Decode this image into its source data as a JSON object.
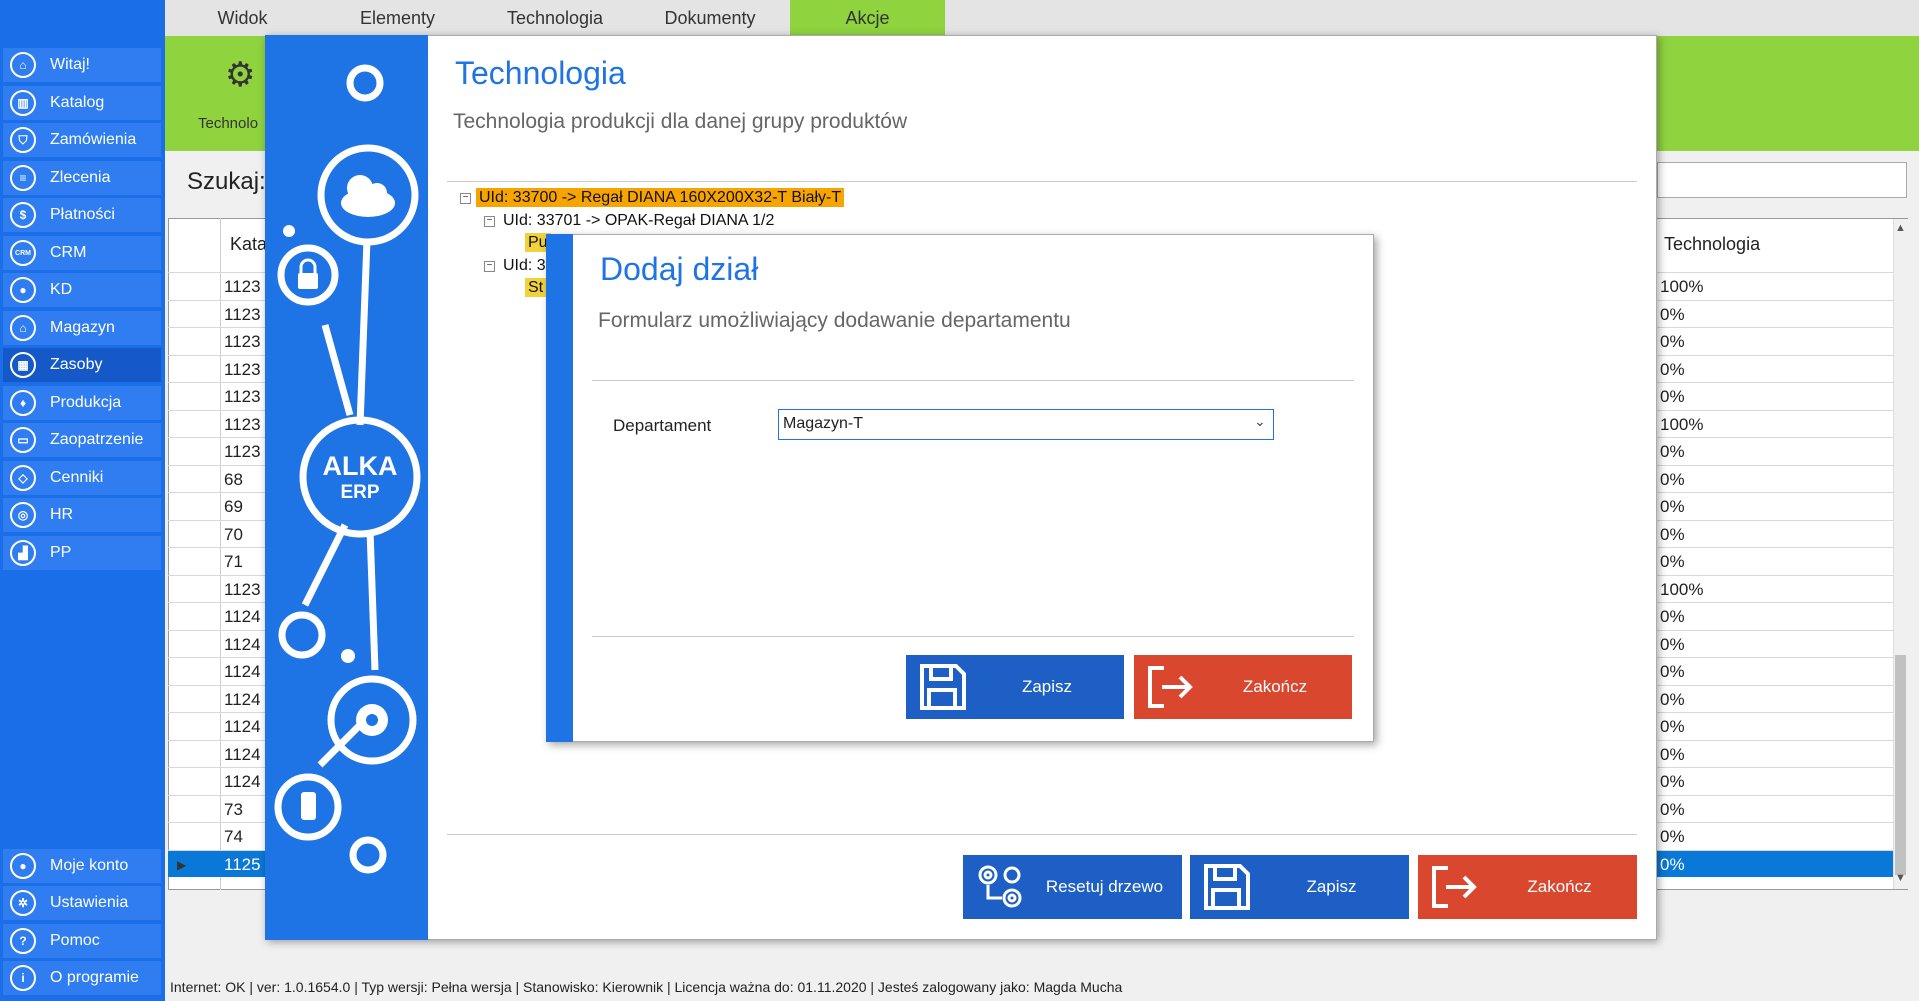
{
  "ribbon": {
    "tabs": [
      {
        "label": "Widok"
      },
      {
        "label": "Elementy"
      },
      {
        "label": "Technologia"
      },
      {
        "label": "Dokumenty"
      },
      {
        "label": "Akcje"
      }
    ],
    "technology_button_label": "Technolo",
    "active_color": "#8fd33f"
  },
  "sidebar": {
    "accent": "#1a6ee8",
    "items": [
      {
        "label": "Witaj!",
        "icon": "home-icon"
      },
      {
        "label": "Katalog",
        "icon": "book-icon"
      },
      {
        "label": "Zamówienia",
        "icon": "cart-icon"
      },
      {
        "label": "Zlecenia",
        "icon": "list-icon"
      },
      {
        "label": "Płatności",
        "icon": "dollar-icon"
      },
      {
        "label": "CRM",
        "icon": "crm-icon"
      },
      {
        "label": "KD",
        "icon": "person-icon"
      },
      {
        "label": "Magazyn",
        "icon": "warehouse-icon"
      },
      {
        "label": "Zasoby",
        "icon": "resources-icon"
      },
      {
        "label": "Produkcja",
        "icon": "production-icon"
      },
      {
        "label": "Zaopatrzenie",
        "icon": "truck-icon"
      },
      {
        "label": "Cenniki",
        "icon": "tag-icon"
      },
      {
        "label": "HR",
        "icon": "hr-icon"
      },
      {
        "label": "PP",
        "icon": "factory-icon"
      }
    ],
    "bottom_items": [
      {
        "label": "Moje konto",
        "icon": "account-icon"
      },
      {
        "label": "Ustawienia",
        "icon": "settings-icon"
      },
      {
        "label": "Pomoc",
        "icon": "help-icon"
      },
      {
        "label": "O programie",
        "icon": "info-icon"
      }
    ]
  },
  "search": {
    "label": "Szukaj:"
  },
  "grid": {
    "col_catalog": "Kata",
    "col_technology": "Technologia",
    "rows": [
      {
        "c1": "1123",
        "c2": "100%"
      },
      {
        "c1": "1123",
        "c2": "0%"
      },
      {
        "c1": "1123",
        "c2": "0%"
      },
      {
        "c1": "1123",
        "c2": "0%"
      },
      {
        "c1": "1123",
        "c2": "0%"
      },
      {
        "c1": "1123",
        "c2": "100%"
      },
      {
        "c1": "1123",
        "c2": "0%"
      },
      {
        "c1": "68",
        "c2": "0%"
      },
      {
        "c1": "69",
        "c2": "0%"
      },
      {
        "c1": "70",
        "c2": "0%"
      },
      {
        "c1": "71",
        "c2": "0%"
      },
      {
        "c1": "1123",
        "c2": "100%"
      },
      {
        "c1": "1124",
        "c2": "0%"
      },
      {
        "c1": "1124",
        "c2": "0%"
      },
      {
        "c1": "1124",
        "c2": "0%"
      },
      {
        "c1": "1124",
        "c2": "0%"
      },
      {
        "c1": "1124",
        "c2": "0%"
      },
      {
        "c1": "1124",
        "c2": "0%"
      },
      {
        "c1": "1124",
        "c2": "0%"
      },
      {
        "c1": "73",
        "c2": "0%"
      },
      {
        "c1": "74",
        "c2": "0%"
      },
      {
        "c1": "1125",
        "c2": "0%",
        "selected": true
      }
    ]
  },
  "tech_dialog": {
    "title": "Technologia",
    "subtitle": "Technologia produkcji dla danej grupy produktów",
    "logo_line1": "ALKA",
    "logo_line2": "ERP",
    "tree": {
      "root": "UId: 33700 -> Regał DIANA 160X200X32-T Biały-T",
      "child1": "UId: 33701 -> OPAK-Regał DIANA    1/2",
      "child1_leaf": "Pu",
      "child2": "UId: 3",
      "child2_leaf": "St"
    },
    "buttons": {
      "reset": "Resetuj drzewo",
      "save": "Zapisz",
      "close": "Zakończ"
    }
  },
  "dodaj_dialog": {
    "title": "Dodaj dział",
    "subtitle": "Formularz umożliwiający dodawanie departamentu",
    "field_label": "Departament",
    "field_value": "Magazyn-T",
    "save": "Zapisz",
    "close": "Zakończ"
  },
  "statusbar": {
    "text": "Internet: OK  |   ver: 1.0.1654.0   |   Typ wersji: Pełna wersja   |   Stanowisko: Kierownik   |   Licencja ważna do: 01.11.2020  |   Jesteś zalogowany jako: Magda Mucha"
  },
  "colors": {
    "brand_blue": "#1e74e4",
    "button_blue": "#1d5fc4",
    "button_red": "#d9472f",
    "tree_highlight": "#f7a300"
  }
}
